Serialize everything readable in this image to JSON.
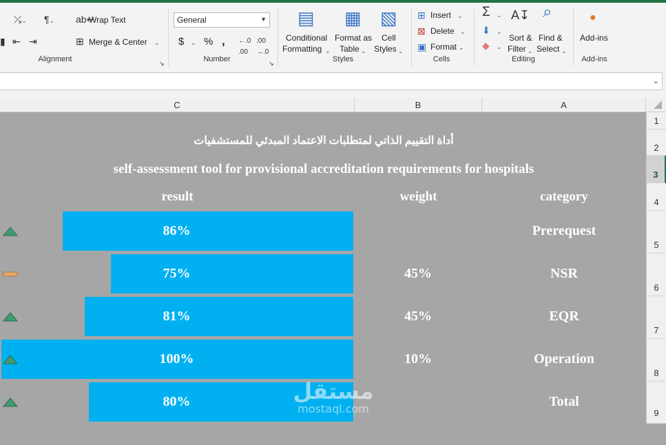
{
  "ribbon": {
    "alignment": {
      "label": "Alignment",
      "wrap_text": "Wrap Text",
      "merge_center": "Merge & Center"
    },
    "number": {
      "label": "Number",
      "format_value": "General",
      "currency": "$",
      "percent": "%",
      "comma": ","
    },
    "styles": {
      "label": "Styles",
      "conditional_formatting_1": "Conditional",
      "conditional_formatting_2": "Formatting",
      "format_as_table_1": "Format as",
      "format_as_table_2": "Table",
      "cell_styles_1": "Cell",
      "cell_styles_2": "Styles"
    },
    "cells": {
      "label": "Cells",
      "insert": "Insert",
      "delete": "Delete",
      "format": "Format"
    },
    "editing": {
      "label": "Editing",
      "sort_filter_1": "Sort &",
      "sort_filter_2": "Filter",
      "find_select_1": "Find &",
      "find_select_2": "Select"
    },
    "addins": {
      "label": "Add-ins",
      "addins_btn": "Add-ins"
    }
  },
  "columns": [
    "C",
    "B",
    "A"
  ],
  "rows": [
    "1",
    "2",
    "3",
    "4",
    "5",
    "6",
    "7",
    "8",
    "9"
  ],
  "sheet": {
    "title_ar": "أداة التقييم الذاتي لمتطلبات الاعتماد المبدئي للمستشفيات",
    "title_en": "self-assessment tool for provisional  accreditation requirements for hospitals",
    "headers": {
      "result": "result",
      "weight": "weight",
      "category": "category"
    },
    "table": [
      {
        "category": "Prerequest",
        "weight": "",
        "result": "86%",
        "value": 0.86,
        "indicator": "up"
      },
      {
        "category": "NSR",
        "weight": "45%",
        "result": "75%",
        "value": 0.75,
        "indicator": "flat"
      },
      {
        "category": "EQR",
        "weight": "45%",
        "result": "81%",
        "value": 0.81,
        "indicator": "up"
      },
      {
        "category": "Operation",
        "weight": "10%",
        "result": "100%",
        "value": 1.0,
        "indicator": "up"
      },
      {
        "category": "Total",
        "weight": "",
        "result": "80%",
        "value": 0.8,
        "indicator": "up"
      }
    ]
  },
  "watermark": {
    "ar": "مستقل",
    "en": "mostaql.com"
  },
  "colors": {
    "bar": "#00b0f0",
    "sheet_bg": "#a6a6a6",
    "excel_green": "#217346",
    "up_icon": "#3f9b6e",
    "flat_icon": "#e8a76a"
  }
}
